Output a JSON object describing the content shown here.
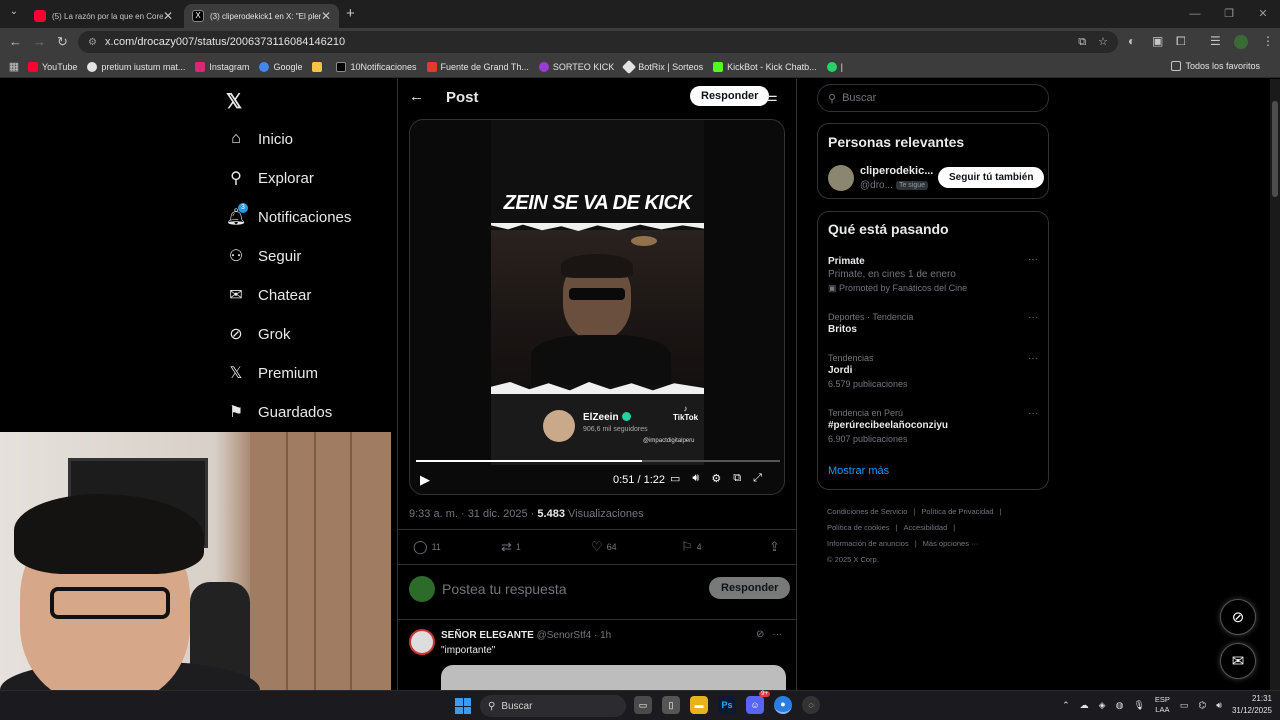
{
  "browser": {
    "tabs": [
      {
        "title": "(5) La razón por la que en Core",
        "favicon_color": "#ff0033"
      },
      {
        "title": "(3) cliperodekick1 en X: \"El plen",
        "favicon_color": "#000000"
      }
    ],
    "new_tab": "+",
    "url": "x.com/drocazy007/status/2006373116084146210",
    "bookmarks": [
      {
        "label": "YouTube",
        "color": "#ff0033"
      },
      {
        "label": "pretium iustum mat...",
        "color": "#e3e3e3"
      },
      {
        "label": "Instagram",
        "color": "#d62976"
      },
      {
        "label": "Google",
        "color": "#4285f4"
      },
      {
        "label": "",
        "color": "#f6c343"
      },
      {
        "label": "10Notificaciones",
        "color": "#000000"
      },
      {
        "label": "Fuente de Grand Th...",
        "color": "#e23b2e"
      },
      {
        "label": "SORTEO KICK",
        "color": "#9b3bd6"
      },
      {
        "label": "BotRix | Sorteos",
        "color": "#e3e3e3"
      },
      {
        "label": "KickBot - Kick Chatb...",
        "color": "#53fc18"
      },
      {
        "label": "|",
        "color": "#25d366"
      }
    ],
    "all_bookmarks": "Todos los favoritos"
  },
  "nav": {
    "items": [
      {
        "label": "Inicio",
        "icon": "home-icon"
      },
      {
        "label": "Explorar",
        "icon": "search-icon"
      },
      {
        "label": "Notificaciones",
        "icon": "bell-icon",
        "badge": "3"
      },
      {
        "label": "Seguir",
        "icon": "follow-icon"
      },
      {
        "label": "Chatear",
        "icon": "mail-icon"
      },
      {
        "label": "Grok",
        "icon": "grok-icon"
      },
      {
        "label": "Premium",
        "icon": "x-icon"
      },
      {
        "label": "Guardados",
        "icon": "bookmark-icon"
      }
    ]
  },
  "post": {
    "header_title": "Post",
    "reply_button": "Responder",
    "video": {
      "overlay_title": "ZEIN SE VA DE KICK",
      "channel_name": "ElZeein",
      "followers": "906,6 mil seguidores",
      "tiktok": "TikTok",
      "watermark": "@impactdigitalperu",
      "time": "0:51 / 1:22",
      "progress": 0.62
    },
    "timestamp": "9:33 a. m. · 31 dic. 2025 · ",
    "views_count": "5.483",
    "views_label": " Visualizaciones",
    "stats": {
      "replies": "11",
      "reposts": "1",
      "likes": "64",
      "bookmarks": "4"
    },
    "compose_placeholder": "Postea tu respuesta",
    "compose_button": "Responder"
  },
  "reply": {
    "name": "SEÑOR ELEGANTE",
    "handle": " @SenorStf4 · 1h",
    "text": "\"importante\""
  },
  "sidebar": {
    "search_placeholder": "Buscar",
    "relevant_title": "Personas relevantes",
    "relevant_user": {
      "name": "cliperodekic...",
      "handle": "@dro...",
      "follows_you": "Te sigue",
      "button": "Seguir tú también"
    },
    "trends_title": "Qué está pasando",
    "trends": [
      {
        "subtitle": "",
        "title": "Primate",
        "desc": "Primate, en cines 1 de enero",
        "promo": "Promoted by Fanáticos del Cine",
        "count": ""
      },
      {
        "subtitle": "Deportes · Tendencia",
        "title": "Britos",
        "desc": "",
        "promo": "",
        "count": ""
      },
      {
        "subtitle": "Tendencias",
        "title": "Jordi",
        "desc": "",
        "promo": "",
        "count": "6.579 publicaciones"
      },
      {
        "subtitle": "Tendencia en Perú",
        "title": "#perúrecibeelañoconziyu",
        "desc": "",
        "promo": "",
        "count": "6.907 publicaciones"
      }
    ],
    "show_more": "Mostrar más",
    "footer_links": [
      "Condiciones de Servicio",
      "|",
      "Política de Privacidad",
      "|",
      "Política de cookies",
      "|",
      "Accesibilidad",
      "|",
      "Información de anuncios",
      "|",
      "Más opciones ···"
    ],
    "copyright": "© 2025 X Corp."
  },
  "taskbar": {
    "search": "Buscar",
    "lang_top": "ESP",
    "lang_bottom": "LAA",
    "time": "21:31",
    "date": "31/12/2025",
    "discord_badge": "9+"
  }
}
